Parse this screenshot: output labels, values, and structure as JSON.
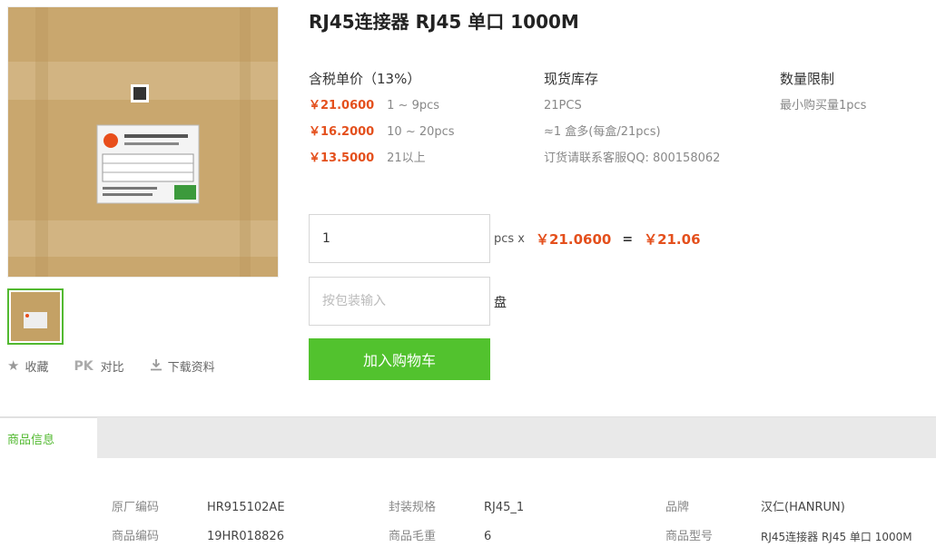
{
  "product": {
    "title": "RJ45连接器 RJ45 单口 1000M"
  },
  "gallery": {
    "main_image_icon": "product-package-photo",
    "thumbnail_icon": "product-thumbnail"
  },
  "actions": {
    "favorite_label": "收藏",
    "compare_badge": "PK",
    "compare_label": "对比",
    "download_label": "下载资料"
  },
  "pricing": {
    "header": "含税单价（13%）",
    "tiers": [
      {
        "price": "￥21.0600",
        "range": "1 ~ 9pcs"
      },
      {
        "price": "￥16.2000",
        "range": "10 ~ 20pcs"
      },
      {
        "price": "￥13.5000",
        "range": "21以上"
      }
    ]
  },
  "stock": {
    "header": "现货库存",
    "lines": [
      "21PCS",
      "≈1 盒多(每盒/21pcs)",
      "订货请联系客服QQ: 800158062"
    ]
  },
  "limit": {
    "header": "数量限制",
    "lines": [
      "最小购买量1pcs"
    ]
  },
  "order": {
    "qty_value": "1",
    "unit_label": "pcs x",
    "unit_price": "￥21.0600",
    "equals": "=",
    "total": "￥21.06",
    "pack_placeholder": "按包装输入",
    "pack_unit": "盘",
    "add_to_cart": "加入购物车"
  },
  "tabs": {
    "active": "商品信息"
  },
  "details": {
    "col1": [
      {
        "label": "原厂编码",
        "value": "HR915102AE"
      },
      {
        "label": "商品编码",
        "value": "19HR018826"
      }
    ],
    "col2": [
      {
        "label": "封装规格",
        "value": "RJ45_1"
      },
      {
        "label": "商品毛重",
        "value": "6"
      }
    ],
    "col3": [
      {
        "label": "品牌",
        "value": "汉仁(HANRUN)"
      },
      {
        "label": "商品型号",
        "value": "RJ45连接器 RJ45 单口 1000M"
      }
    ]
  },
  "colors": {
    "accent_green": "#52c22e",
    "price_orange": "#e4501d"
  }
}
